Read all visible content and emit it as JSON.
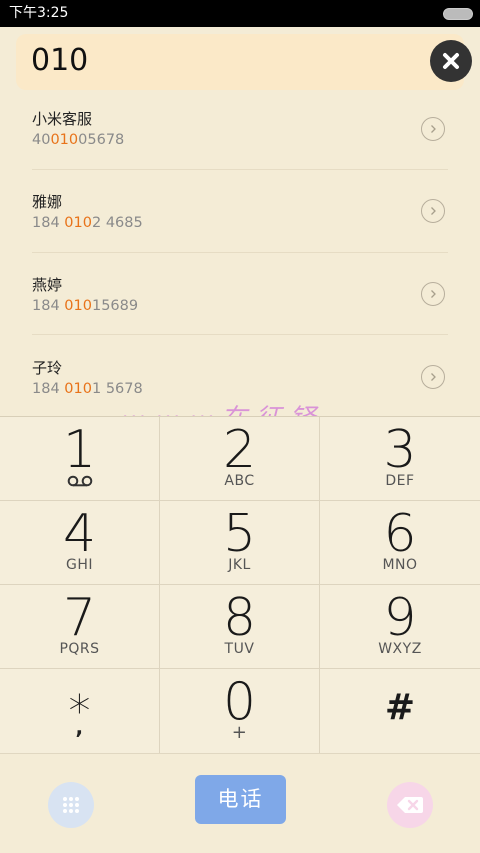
{
  "status_bar": {
    "time": "下午3:25"
  },
  "search": {
    "query": "010"
  },
  "results": [
    {
      "name": "小米客服",
      "number_pre": "40",
      "number_hl": "010",
      "number_post": "05678"
    },
    {
      "name": "雅娜",
      "number_pre": "184 ",
      "number_hl": "010",
      "number_post": "2 4685"
    },
    {
      "name": "燕婷",
      "number_pre": "184 ",
      "number_hl": "010",
      "number_post": "15689"
    },
    {
      "name": "子玲",
      "number_pre": "184 ",
      "number_hl": "010",
      "number_post": "1 5678"
    }
  ],
  "watermark": "⋯ ⋯ ⋯ 在 征 铎",
  "keypad": [
    {
      "digit": "1",
      "letters": ""
    },
    {
      "digit": "2",
      "letters": "ABC"
    },
    {
      "digit": "3",
      "letters": "DEF"
    },
    {
      "digit": "4",
      "letters": "GHI"
    },
    {
      "digit": "5",
      "letters": "JKL"
    },
    {
      "digit": "6",
      "letters": "MNO"
    },
    {
      "digit": "7",
      "letters": "PQRS"
    },
    {
      "digit": "8",
      "letters": "TUV"
    },
    {
      "digit": "9",
      "letters": "WXYZ"
    },
    {
      "digit": "*",
      "letters": ","
    },
    {
      "digit": "0",
      "letters": "+"
    },
    {
      "digit": "#",
      "letters": ""
    }
  ],
  "bottom": {
    "call_label": "电话"
  },
  "colors": {
    "highlight": "#e8731a",
    "call_button": "#7fa8e8",
    "search_bg": "#fbe9c8"
  },
  "icons": {
    "clear": "close-icon",
    "detail": "chevron-right-icon",
    "voicemail": "voicemail-icon",
    "dialpad": "dialpad-icon",
    "delete": "backspace-icon"
  }
}
